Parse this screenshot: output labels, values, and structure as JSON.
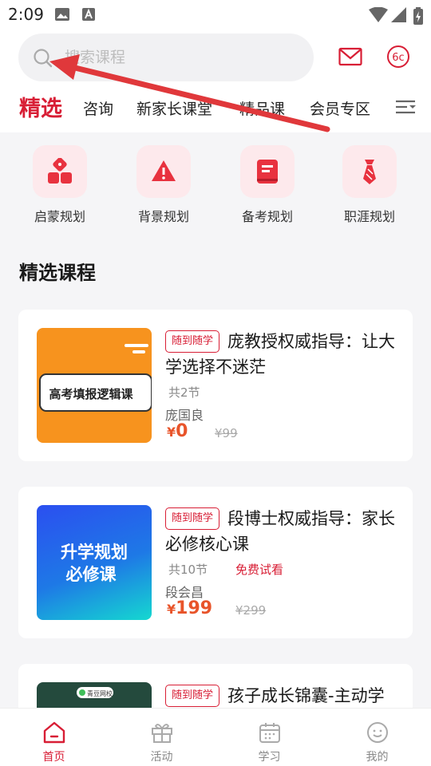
{
  "status": {
    "time": "2:09"
  },
  "search": {
    "placeholder": "搜索课程"
  },
  "header": {
    "badge_text": "6c"
  },
  "tabs": [
    {
      "label": "精选"
    },
    {
      "label": "咨询"
    },
    {
      "label": "新家长课堂"
    },
    {
      "label": "精品课"
    },
    {
      "label": "会员专区"
    }
  ],
  "categories": [
    {
      "label": "启蒙规划",
      "icon": "blocks-icon"
    },
    {
      "label": "背景规划",
      "icon": "warning-triangle-icon"
    },
    {
      "label": "备考规划",
      "icon": "book-icon"
    },
    {
      "label": "职涯规划",
      "icon": "necktie-icon"
    }
  ],
  "section": {
    "title": "精选课程"
  },
  "courses": [
    {
      "tag": "随到随学",
      "title": "庞教授权威指导：让大学选择不迷茫",
      "lessons": "共2节",
      "trial": "",
      "teacher": "庞国良",
      "price_symbol": "¥",
      "price": "0",
      "original_price": "¥99",
      "thumb_text": "高考填报逻辑课",
      "thumb_color": "#f7931e"
    },
    {
      "tag": "随到随学",
      "title": "段博士权威指导：家长必修核心课",
      "lessons": "共10节",
      "trial": "免费试看",
      "teacher": "段会昌",
      "price_symbol": "¥",
      "price": "199",
      "original_price": "¥299",
      "thumb_text_line1": "升学规划",
      "thumb_text_line2": "必修课",
      "thumb_color": "#1f6ff0"
    },
    {
      "tag": "随到随学",
      "title": "孩子成长锦囊-主动学",
      "thumb_brand": "青豆网校",
      "thumb_color": "#244a3d"
    }
  ],
  "bottom_nav": [
    {
      "label": "首页",
      "icon": "home-icon",
      "active": true
    },
    {
      "label": "活动",
      "icon": "gift-icon",
      "active": false
    },
    {
      "label": "学习",
      "icon": "calendar-icon",
      "active": false
    },
    {
      "label": "我的",
      "icon": "smiley-icon",
      "active": false
    }
  ],
  "colors": {
    "accent": "#d81e35",
    "price": "#e8542a",
    "annotation_arrow": "#e0383b"
  }
}
